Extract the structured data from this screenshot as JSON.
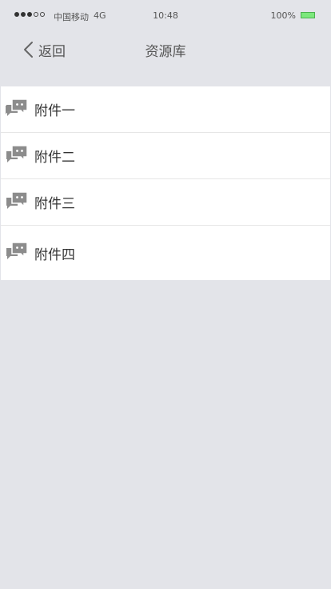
{
  "status_bar": {
    "carrier": "中国移动",
    "network": "4G",
    "time": "10:48",
    "battery": "100%",
    "battery_color": "#7ce87c"
  },
  "nav": {
    "back_label": "返回",
    "title": "资源库"
  },
  "items": [
    {
      "label": "附件一",
      "icon": "chat-bubbles-icon"
    },
    {
      "label": "附件二",
      "icon": "chat-bubbles-icon"
    },
    {
      "label": "附件三",
      "icon": "chat-bubbles-icon"
    },
    {
      "label": "附件四",
      "icon": "chat-bubbles-icon"
    }
  ],
  "colors": {
    "background": "#e3e4e9",
    "icon": "#8c8c8c"
  }
}
